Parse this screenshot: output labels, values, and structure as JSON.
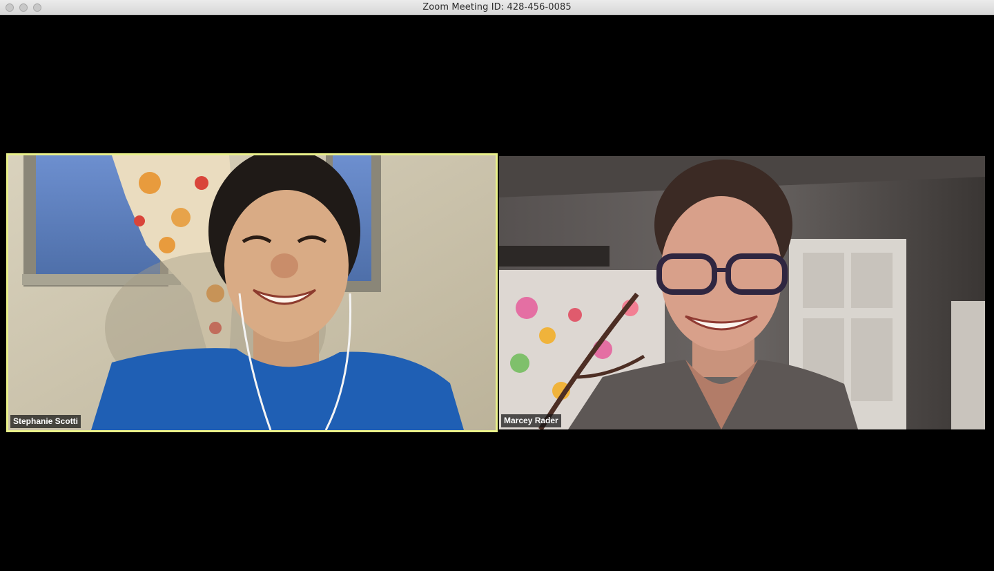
{
  "window": {
    "title": "Zoom Meeting ID: 428-456-0085"
  },
  "participants": [
    {
      "name": "Stephanie Scotti",
      "active_speaker": true
    },
    {
      "name": "Marcey Rader",
      "active_speaker": false
    }
  ],
  "colors": {
    "active_speaker_border": "#e9f08a",
    "background": "#000000"
  }
}
